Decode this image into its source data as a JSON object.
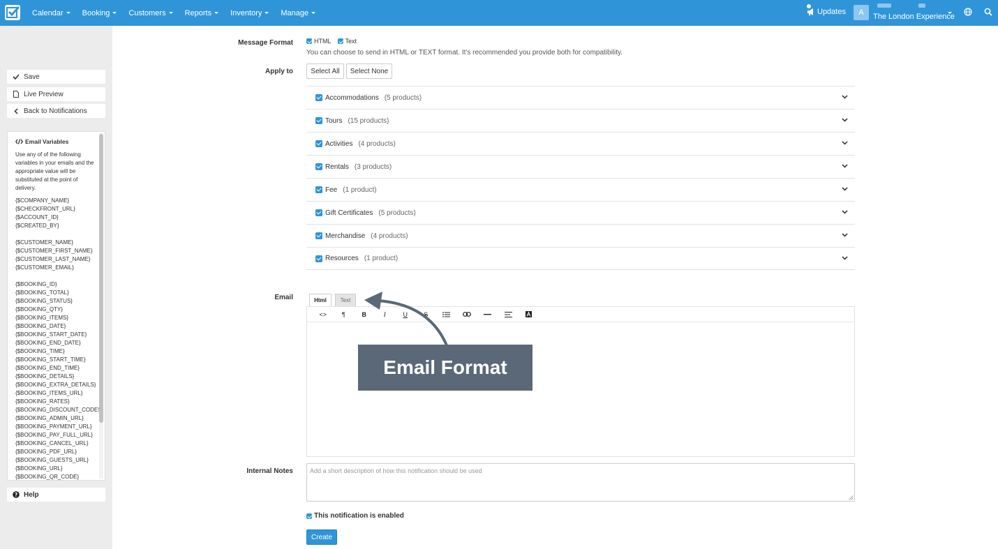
{
  "nav": {
    "items": [
      {
        "label": "Calendar"
      },
      {
        "label": "Booking"
      },
      {
        "label": "Customers"
      },
      {
        "label": "Reports"
      },
      {
        "label": "Inventory"
      },
      {
        "label": "Manage"
      }
    ],
    "updates_label": "Updates",
    "avatar_initial": "A",
    "account_name": "The London Experience"
  },
  "sidebar": {
    "save_label": "Save",
    "preview_label": "Live Preview",
    "back_label": "Back to Notifications",
    "help_label": "Help",
    "variables": {
      "title": "Email Variables",
      "description": "Use any of of the following variables in your emails and the appropriate value will be substituted at the point of delivery.",
      "groups": [
        [
          "{$COMPANY_NAME}",
          "{$CHECKFRONT_URL}",
          "{$ACCOUNT_ID}",
          "{$CREATED_BY}"
        ],
        [
          "{$CUSTOMER_NAME}",
          "{$CUSTOMER_FIRST_NAME}",
          "{$CUSTOMER_LAST_NAME}",
          "{$CUSTOMER_EMAIL}"
        ],
        [
          "{$BOOKING_ID}",
          "{$BOOKING_TOTAL}",
          "{$BOOKING_STATUS}",
          "{$BOOKING_QTY}",
          "{$BOOKING_ITEMS}",
          "{$BOOKING_DATE}",
          "{$BOOKING_START_DATE}",
          "{$BOOKING_END_DATE}",
          "{$BOOKING_TIME}",
          "{$BOOKING_START_TIME}",
          "{$BOOKING_END_TIME}",
          "{$BOOKING_DETAILS}",
          "{$BOOKING_EXTRA_DETAILS}",
          "{$BOOKING_ITEMS_URL}",
          "{$BOOKING_RATES}",
          "{$BOOKING_DISCOUNT_CODES}",
          "{$BOOKING_ADMIN_URL}",
          "{$BOOKING_PAYMENT_URL}",
          "{$BOOKING_PAY_FULL_URL}",
          "{$BOOKING_CANCEL_URL}",
          "{$BOOKING_PDF_URL}",
          "{$BOOKING_GUESTS_URL}",
          "{$BOOKING_URL}",
          "{$BOOKING_QR_CODE}"
        ]
      ]
    }
  },
  "form": {
    "message_format_label": "Message Format",
    "format_html": "HTML",
    "format_text": "Text",
    "format_hint": "You can choose to send in HTML or TEXT format. It's recommended you provide both for compatibility.",
    "apply_to_label": "Apply to",
    "select_all": "Select All",
    "select_none": "Select None",
    "products": [
      {
        "name": "Accommodations",
        "count": "(5 products)"
      },
      {
        "name": "Tours",
        "count": "(15 products)"
      },
      {
        "name": "Activities",
        "count": "(4 products)"
      },
      {
        "name": "Rentals",
        "count": "(3 products)"
      },
      {
        "name": "Fee",
        "count": "(1 product)"
      },
      {
        "name": "Gift Certificates",
        "count": "(5 products)"
      },
      {
        "name": "Merchandise",
        "count": "(4 products)"
      },
      {
        "name": "Resources",
        "count": "(1 product)"
      }
    ],
    "email_label": "Email",
    "tab_html": "Html",
    "tab_text": "Text",
    "toolbar": {
      "code": "<>",
      "paragraph": "¶",
      "bold": "B",
      "italic": "I",
      "underline": "U",
      "strike": "S"
    },
    "callout": "Email Format",
    "internal_notes_label": "Internal Notes",
    "internal_notes_placeholder": "Add a short description of how this notification should be used",
    "enabled_label": "This notification is enabled",
    "create_label": "Create"
  },
  "colors": {
    "brand": "#2f95d8",
    "callout_bg": "#5a6877",
    "sidebar_bg": "#ececec"
  }
}
